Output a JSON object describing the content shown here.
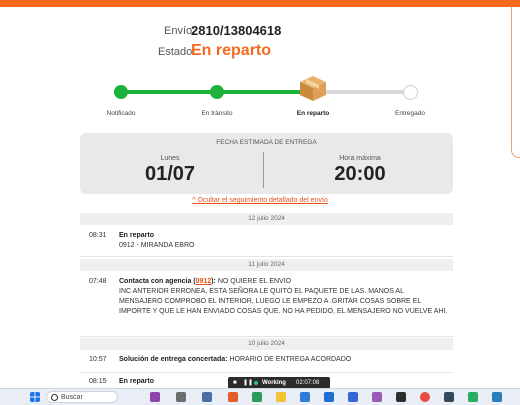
{
  "shipment": {
    "envio_label": "Envío:",
    "envio_number": "2810/13804618",
    "estado_label": "Estado:",
    "estado_value": "En reparto"
  },
  "tracker": {
    "steps": [
      {
        "label": "Notificado",
        "state": "done"
      },
      {
        "label": "En tránsito",
        "state": "done"
      },
      {
        "label": "En reparto",
        "state": "current"
      },
      {
        "label": "Entregado",
        "state": "pending"
      }
    ],
    "colors": {
      "done": "#1db33a",
      "pending": "#d8d8d8",
      "accent": "#f46b1f"
    }
  },
  "estimate": {
    "title": "FECHA ESTIMADA DE ENTREGA",
    "day_name": "Lunes",
    "date": "01/07",
    "time_label": "Hora máxima",
    "time": "20:00"
  },
  "toggle_link": "Ocultar el seguimiento detallado del envío",
  "history": {
    "groups": [
      {
        "date": "12 julio 2024",
        "events": [
          {
            "time": "08:31",
            "title": "En reparto",
            "detail": "0912 - MIRANDA EBRO"
          }
        ]
      },
      {
        "date": "11 julio 2024",
        "events": [
          {
            "time": "07:48",
            "title": "Contacta con agencia (",
            "code": "0912",
            "title_end": "):",
            "summary": "NO QUIERE EL ENVIO",
            "detail": "INC ANTERIOR ERRONEA, ESTA SEÑORA LE QUITÓ EL PAQUETE DE LAS. MANOS AL MENSAJERO COMPROBO EL INTERIOR, LUEGO LE EMPEZO A .GRITAR COSAS SOBRE EL IMPORTE Y QUE LE HAN ENVIADO COSAS QUE. NO HA PEDIDO, EL MENSAJERO NO VUELVE AHI."
          }
        ]
      },
      {
        "date": "10 julio 2024",
        "events": [
          {
            "time": "10:57",
            "title": "Solución de entrega concertada:",
            "detail": "HORARIO DE ENTREGA ACORDADO"
          },
          {
            "time": "08:15",
            "title": "En reparto",
            "detail": ""
          }
        ]
      }
    ]
  },
  "taskbar": {
    "search_text": "Buscar",
    "recording_status": "Working",
    "recording_time": "02:07:08"
  }
}
